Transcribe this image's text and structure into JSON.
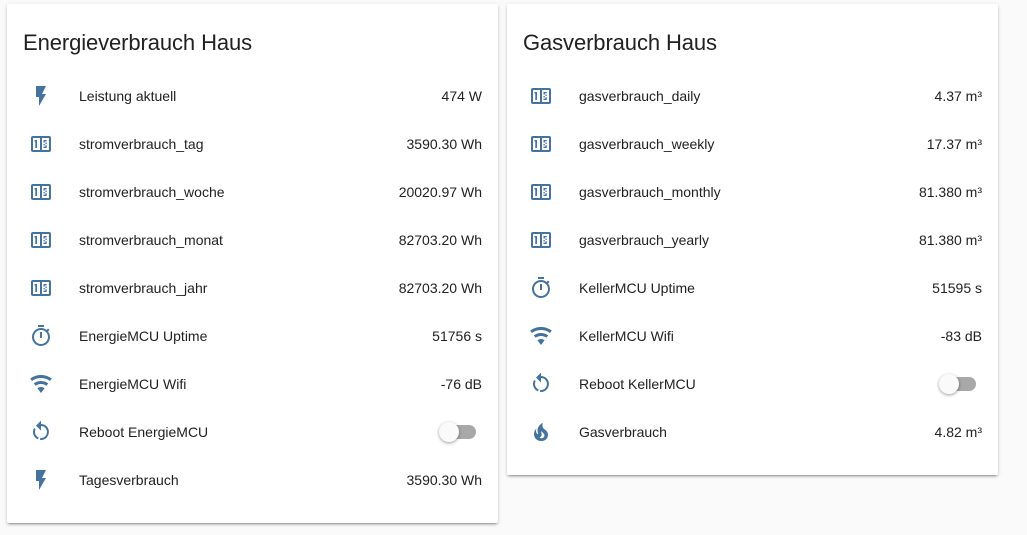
{
  "colors": {
    "icon": "#44739e",
    "card": "#ffffff",
    "background": "#fafafa"
  },
  "cards": [
    {
      "title": "Energieverbrauch Haus",
      "rows": [
        {
          "icon": "flash-icon",
          "name": "Leistung aktuell",
          "value": "474 W"
        },
        {
          "icon": "counter-icon",
          "name": "stromverbrauch_tag",
          "value": "3590.30 Wh"
        },
        {
          "icon": "counter-icon",
          "name": "stromverbrauch_woche",
          "value": "20020.97 Wh"
        },
        {
          "icon": "counter-icon",
          "name": "stromverbrauch_monat",
          "value": "82703.20 Wh"
        },
        {
          "icon": "counter-icon",
          "name": "stromverbrauch_jahr",
          "value": "82703.20 Wh"
        },
        {
          "icon": "timer-icon",
          "name": "EnergieMCU Uptime",
          "value": "51756 s"
        },
        {
          "icon": "wifi-icon",
          "name": "EnergieMCU Wifi",
          "value": "-76 dB"
        },
        {
          "icon": "restart-icon",
          "name": "Reboot EnergieMCU",
          "toggle": "off"
        },
        {
          "icon": "flash-icon",
          "name": "Tagesverbrauch",
          "value": "3590.30 Wh"
        }
      ]
    },
    {
      "title": "Gasverbrauch Haus",
      "rows": [
        {
          "icon": "counter-icon",
          "name": "gasverbrauch_daily",
          "value": "4.37 m³"
        },
        {
          "icon": "counter-icon",
          "name": "gasverbrauch_weekly",
          "value": "17.37 m³"
        },
        {
          "icon": "counter-icon",
          "name": "gasverbrauch_monthly",
          "value": "81.380 m³"
        },
        {
          "icon": "counter-icon",
          "name": "gasverbrauch_yearly",
          "value": "81.380 m³"
        },
        {
          "icon": "timer-icon",
          "name": "KellerMCU Uptime",
          "value": "51595 s"
        },
        {
          "icon": "wifi-icon",
          "name": "KellerMCU Wifi",
          "value": "-83 dB"
        },
        {
          "icon": "restart-icon",
          "name": "Reboot KellerMCU",
          "toggle": "off"
        },
        {
          "icon": "fire-icon",
          "name": "Gasverbrauch",
          "value": "4.82 m³"
        }
      ]
    }
  ]
}
